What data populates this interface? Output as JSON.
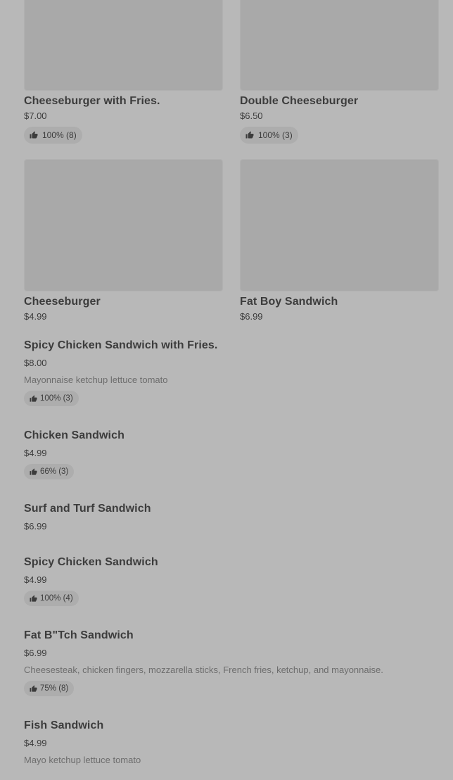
{
  "grid_items": [
    {
      "name": "Cheeseburger with Fries.",
      "price": "$7.00",
      "rating": "100% (8)"
    },
    {
      "name": "Double Cheeseburger",
      "price": "$6.50",
      "rating": "100% (3)"
    },
    {
      "name": "Cheeseburger",
      "price": "$4.99"
    },
    {
      "name": "Fat Boy Sandwich",
      "price": "$6.99"
    }
  ],
  "list_items": [
    {
      "name": "Spicy Chicken Sandwich with Fries.",
      "price": "$8.00",
      "description": "Mayonnaise ketchup lettuce tomato",
      "rating": "100% (3)"
    },
    {
      "name": "Chicken Sandwich",
      "price": "$4.99",
      "rating": "66% (3)"
    },
    {
      "name": "Surf and Turf Sandwich",
      "price": "$6.99"
    },
    {
      "name": "Spicy Chicken Sandwich",
      "price": "$4.99",
      "rating": "100% (4)"
    },
    {
      "name": "Fat B\"Tch Sandwich",
      "price": "$6.99",
      "description": "Cheesesteak, chicken fingers, mozzarella sticks, French fries, ketchup, and mayonnaise.",
      "rating": "75% (8)"
    },
    {
      "name": "Fish Sandwich",
      "price": "$4.99",
      "description": "Mayo ketchup lettuce tomato"
    }
  ],
  "icons": {
    "rating": "thumbs-up-icon"
  },
  "colors": {
    "background": "#b8b8b8",
    "placeholder": "#a9a9a9",
    "badge": "#adadad",
    "text": "#3c3c3c",
    "muted": "#6d6d6d"
  }
}
